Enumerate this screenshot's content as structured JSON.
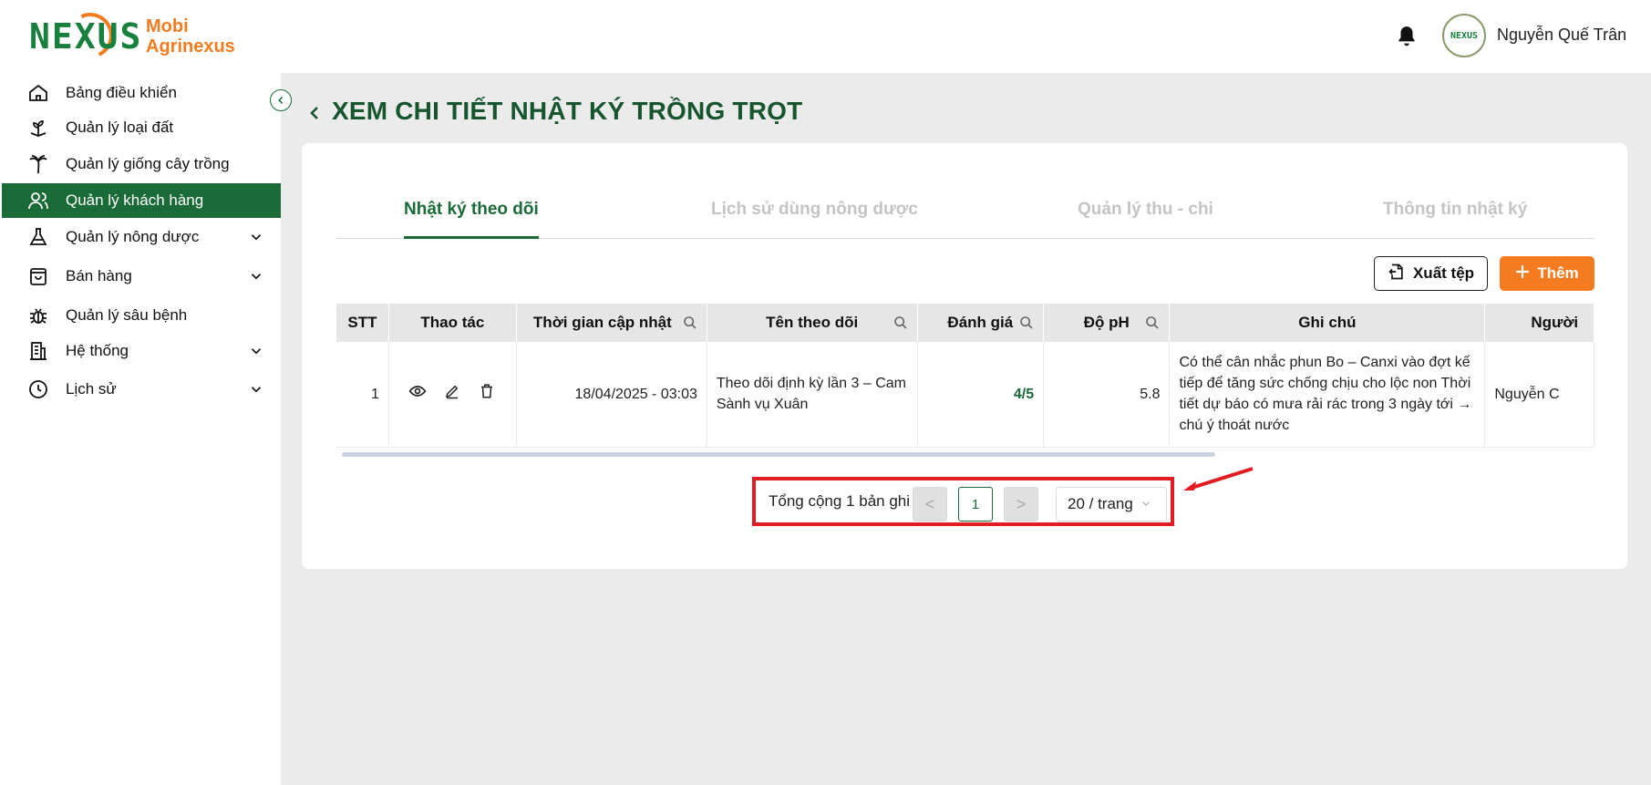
{
  "brand": {
    "logo_text": "NEXUS",
    "line1": "Mobi",
    "line2": "Agrinexus",
    "primary_color": "#1a6b37",
    "accent_color": "#f47b20"
  },
  "header": {
    "avatar_text": "NEXUS",
    "user_name": "Nguyễn Quế Trân"
  },
  "sidebar": {
    "items": [
      {
        "label": "Bảng điều khiển",
        "icon": "home-icon"
      },
      {
        "label": "Quản lý loại đất",
        "icon": "soil-sprout-icon"
      },
      {
        "label": "Quản lý giống cây trồng",
        "icon": "palm-tree-icon"
      },
      {
        "label": "Quản lý khách hàng",
        "icon": "users-icon",
        "active": true
      },
      {
        "label": "Quản lý nông dược",
        "icon": "flask-icon",
        "expandable": true
      },
      {
        "label": "Bán hàng",
        "icon": "shopping-bag-icon",
        "expandable": true
      },
      {
        "label": "Quản lý sâu bệnh",
        "icon": "bug-icon"
      },
      {
        "label": "Hệ thống",
        "icon": "building-icon",
        "expandable": true
      },
      {
        "label": "Lịch sử",
        "icon": "clock-icon",
        "expandable": true
      }
    ]
  },
  "page": {
    "title": "XEM CHI TIẾT NHẬT KÝ TRỒNG TRỌT"
  },
  "tabs": [
    {
      "label": "Nhật ký theo dõi",
      "active": true
    },
    {
      "label": "Lịch sử dùng nông dược"
    },
    {
      "label": "Quản lý thu - chi"
    },
    {
      "label": "Thông tin nhật ký"
    }
  ],
  "toolbar": {
    "export_label": "Xuất tệp",
    "add_label": "Thêm"
  },
  "table": {
    "columns": [
      "STT",
      "Thao tác",
      "Thời gian cập nhật",
      "Tên theo dõi",
      "Đánh giá",
      "Độ pH",
      "Ghi chú",
      "Người"
    ],
    "rows": [
      {
        "stt": "1",
        "updated": "18/04/2025 - 03:03",
        "name": "Theo dõi định kỳ lần 3 – Cam Sành vụ Xuân",
        "rating": "4/5",
        "ph": "5.8",
        "note": "Có thể cân nhắc phun Bo – Canxi vào đợt kế tiếp để tăng sức chống chịu cho lộc non Thời tiết dự báo có mưa rải rác trong 3 ngày tới → chú ý thoát nước",
        "person": "Nguyễn C"
      }
    ]
  },
  "pagination": {
    "total_text": "Tổng cộng 1 bản ghi",
    "prev": "<",
    "current_page": "1",
    "next": ">",
    "page_size": "20 / trang"
  }
}
